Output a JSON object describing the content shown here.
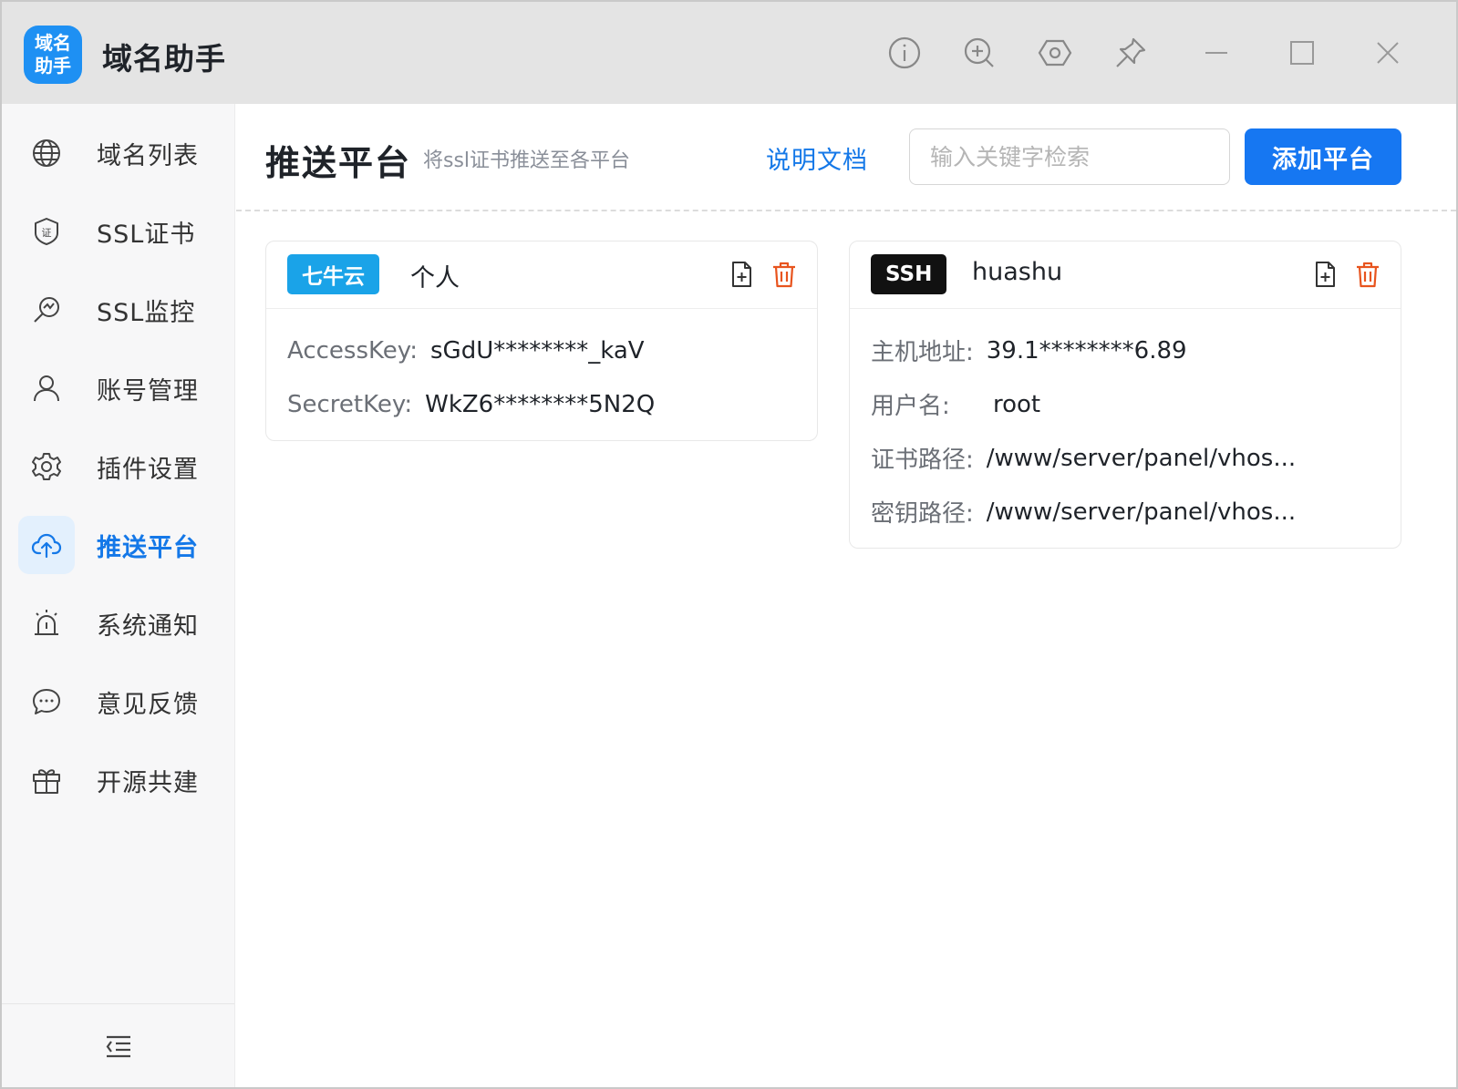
{
  "app": {
    "logo_line1": "域名",
    "logo_line2": "助手",
    "title": "域名助手"
  },
  "titlebar_icons": [
    "info-icon",
    "zoom-in-icon",
    "hexagon-settings-icon",
    "pin-icon",
    "minimize-icon",
    "maximize-icon",
    "close-icon"
  ],
  "sidebar": {
    "items": [
      {
        "label": "域名列表",
        "icon": "globe-icon"
      },
      {
        "label": "SSL证书",
        "icon": "certificate-shield-icon"
      },
      {
        "label": "SSL监控",
        "icon": "monitor-search-icon"
      },
      {
        "label": "账号管理",
        "icon": "user-icon"
      },
      {
        "label": "插件设置",
        "icon": "gear-icon"
      },
      {
        "label": "推送平台",
        "icon": "cloud-upload-icon",
        "active": true
      },
      {
        "label": "系统通知",
        "icon": "alarm-icon"
      },
      {
        "label": "意见反馈",
        "icon": "chat-icon"
      },
      {
        "label": "开源共建",
        "icon": "gift-icon"
      }
    ],
    "footer_icon": "collapse-menu-icon"
  },
  "main": {
    "title": "推送平台",
    "subtitle": "将ssl证书推送至各平台",
    "doc_link": "说明文档",
    "search_placeholder": "输入关键字检索",
    "add_button": "添加平台"
  },
  "cards": [
    {
      "tag": "七牛云",
      "tag_color": "#1aa3e8",
      "name": "个人",
      "fields": [
        {
          "label": "AccessKey:",
          "value": "sGdU********_kaV"
        },
        {
          "label": "SecretKey:",
          "value": "WkZ6********5N2Q"
        }
      ]
    },
    {
      "tag": "SSH",
      "tag_color": "#111111",
      "name": "huashu",
      "fields": [
        {
          "label": "主机地址:",
          "value": "39.1********6.89"
        },
        {
          "label": "用户名:",
          "value": "root"
        },
        {
          "label": "证书路径:",
          "value": "/www/server/panel/vhos..."
        },
        {
          "label": "密钥路径:",
          "value": "/www/server/panel/vhos..."
        }
      ]
    }
  ],
  "colors": {
    "accent": "#1677f2",
    "delete": "#e8541e",
    "sidebar_active_bg": "#e3f0fd"
  }
}
